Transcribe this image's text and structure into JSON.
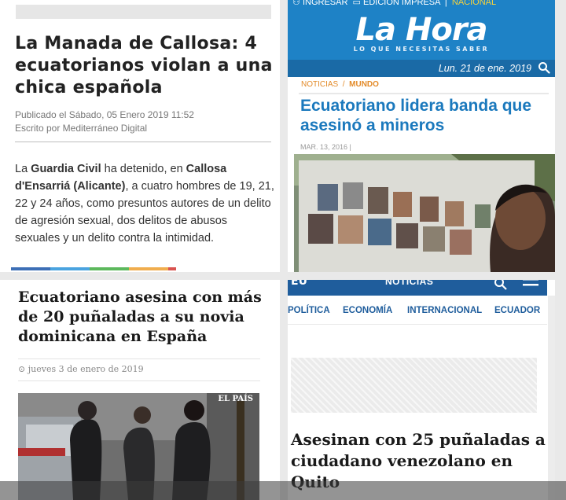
{
  "panel1": {
    "title": "La Manada de Callosa: 4 ecuatorianos violan a una chica española",
    "published": "Publicado el Sábado, 05 Enero 2019 11:52",
    "author": "Escrito por Mediterráneo Digital",
    "body": {
      "b1": "Guardia Civil",
      "b2": "Callosa d'Ensarriá (Alicante)",
      "t0": "La ",
      "t1": " ha detenido, en ",
      "t2": ", a cuatro hombres de 19, 21, 22 y 24 años, como presuntos autores de un delito de agresión sexual, dos delitos de abusos sexuales y un delito contra la intimidad."
    },
    "bar_colors": [
      "#3d6fb6",
      "#4aa3df",
      "#5cb85c",
      "#f0ad4e",
      "#d9534f"
    ]
  },
  "panel2": {
    "toplinks": {
      "ingresar": "INGRESAR",
      "edicion": "EDICIÓN IMPRESA",
      "sep": "|",
      "nacional": "NACIONAL"
    },
    "logo": "La Hora",
    "slogan": "LO QUE NECESITAS SABER",
    "date": "Lun. 21 de ene. 2019",
    "breadcrumb": {
      "root": "NOTICIAS",
      "sep": "/",
      "section": "MUNDO"
    },
    "headline": "Ecuatoriano lidera banda que asesinó a mineros",
    "pubdate": "MAR. 13, 2016 |",
    "colors": {
      "brand": "#1e82c6",
      "accent": "#e38b2a"
    }
  },
  "panel3": {
    "title": "Ecuatoriano asesina con más de 20 puñaladas a su novia dominicana en España",
    "date": "jueves 3 de enero de 2019",
    "photo_credit": "EL PAÍS"
  },
  "panel4": {
    "logo": "EU",
    "nav_label": "NOTICIAS",
    "categories": [
      "POLÍTICA",
      "ECONOMÍA",
      "INTERNACIONAL",
      "ECUADOR"
    ],
    "title": "Asesinan con 25 puñaladas a ciudadano venezolano en Quito"
  }
}
